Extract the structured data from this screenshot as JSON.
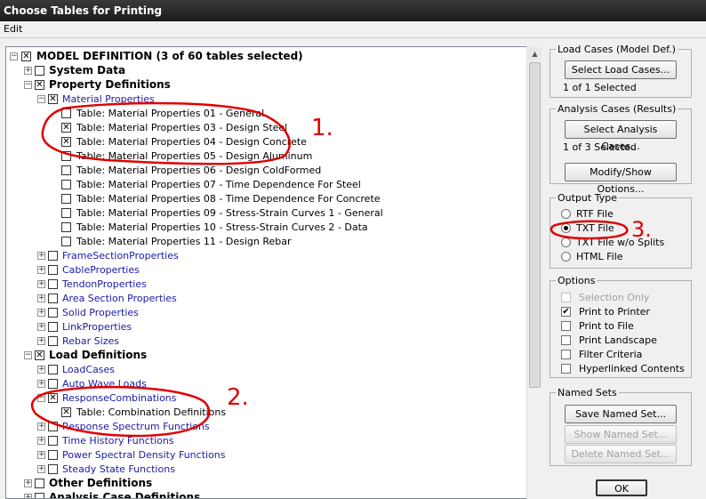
{
  "window": {
    "title": "Choose Tables for Printing"
  },
  "menu": {
    "edit": "Edit"
  },
  "tree": {
    "root": "MODEL DEFINITION  (3 of 60 tables selected)",
    "system_data": "System Data",
    "property_definitions": "Property Definitions",
    "material_properties": "Material Properties",
    "tables": [
      {
        "label": "Table:  Material Properties 01 - General",
        "checked": false
      },
      {
        "label": "Table:  Material Properties 03 - Design Steel",
        "checked": true
      },
      {
        "label": "Table:  Material Properties 04 - Design Concrete",
        "checked": true
      },
      {
        "label": "Table:  Material Properties 05 - Design Aluminum",
        "checked": false
      },
      {
        "label": "Table:  Material Properties 06 - Design ColdFormed",
        "checked": false
      },
      {
        "label": "Table:  Material Properties 07 - Time Dependence For Steel",
        "checked": false
      },
      {
        "label": "Table:  Material Properties 08 - Time Dependence For Concrete",
        "checked": false
      },
      {
        "label": "Table:  Material Properties 09 - Stress-Strain Curves 1 - General",
        "checked": false
      },
      {
        "label": "Table:  Material Properties 10 - Stress-Strain Curves 2 - Data",
        "checked": false
      },
      {
        "label": "Table:  Material Properties 11 - Design Rebar",
        "checked": false
      }
    ],
    "property_items": [
      "FrameSectionProperties",
      "CableProperties",
      "TendonProperties",
      "Area Section Properties",
      "Solid Properties",
      "LinkProperties",
      "Rebar Sizes"
    ],
    "load_definitions": "Load Definitions",
    "load_cases": "LoadCases",
    "auto_wave_loads": "Auto Wave Loads",
    "response_combinations": "ResponseCombinations",
    "combination_table": "Table:  Combination Definitions",
    "load_items": [
      "Response Spectrum Functions",
      "Time History Functions",
      "Power Spectral Density Functions",
      "Steady State Functions"
    ],
    "other_definitions": "Other Definitions",
    "analysis_case_definitions": "Analysis Case Definitions"
  },
  "load_cases_panel": {
    "title": "Load Cases (Model Def.)",
    "button": "Select Load Cases...",
    "status": "1 of 1 Selected"
  },
  "analysis_cases_panel": {
    "title": "Analysis Cases (Results)",
    "button": "Select Analysis Cases...",
    "status": "1 of 3 Selected",
    "modify_button": "Modify/Show Options..."
  },
  "output_type": {
    "title": "Output Type",
    "options": [
      "RTF File",
      "TXT File",
      "TXT File w/o Splits",
      "HTML File"
    ],
    "selected": "TXT File"
  },
  "options": {
    "title": "Options",
    "items": [
      {
        "label": "Selection Only",
        "checked": false,
        "disabled": true
      },
      {
        "label": "Print to Printer",
        "checked": true,
        "disabled": false
      },
      {
        "label": "Print to File",
        "checked": false,
        "disabled": false
      },
      {
        "label": "Print Landscape",
        "checked": false,
        "disabled": false
      },
      {
        "label": "Filter Criteria",
        "checked": false,
        "disabled": false
      },
      {
        "label": "Hyperlinked Contents",
        "checked": false,
        "disabled": false
      }
    ]
  },
  "named_sets": {
    "title": "Named Sets",
    "save": "Save Named Set...",
    "show": "Show Named Set...",
    "delete": "Delete Named Set..."
  },
  "ok_button": "OK",
  "annotations": {
    "one": "1.",
    "two": "2.",
    "three": "3.",
    "color": "#e00000"
  }
}
